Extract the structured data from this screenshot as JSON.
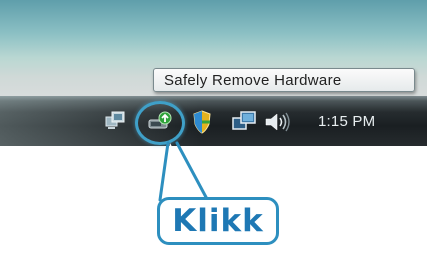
{
  "tooltip": {
    "text": "Safely Remove Hardware"
  },
  "tray": {
    "clock": "1:15 PM",
    "icons": [
      "network-icon",
      "safely-remove-hardware-icon",
      "security-shield-icon",
      "display-icon",
      "volume-icon"
    ]
  },
  "callout": {
    "label": "Klikk"
  },
  "colors": {
    "desktop_top": "#5f9eab",
    "taskbar": "#1a1f22",
    "highlight": "#3fa0c8",
    "callout_border": "#2d8fbf",
    "callout_text": "#1e78b4"
  }
}
